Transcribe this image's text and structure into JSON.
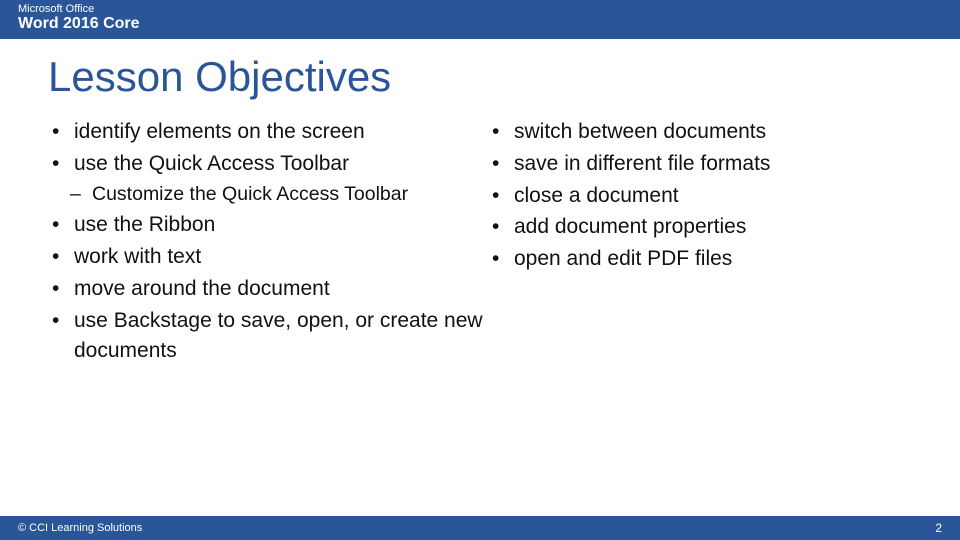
{
  "header": {
    "brand": "Microsoft Office",
    "product": "Word 2016 Core"
  },
  "title": "Lesson Objectives",
  "objectives": {
    "left": {
      "items": [
        "identify elements on the screen",
        "use the Quick Access Toolbar",
        "use the Ribbon",
        "work with text",
        "move around the document",
        "use Backstage to save, open, or create new documents"
      ],
      "sub_after_index": 1,
      "sub_items": [
        "Customize the Quick Access Toolbar"
      ]
    },
    "right": {
      "items": [
        "switch between documents",
        "save in different file formats",
        "close a document",
        "add document properties",
        "open and edit PDF files"
      ]
    }
  },
  "footer": {
    "copyright": "© CCI Learning Solutions",
    "page_number": "2"
  },
  "colors": {
    "accent": "#2a5699"
  }
}
